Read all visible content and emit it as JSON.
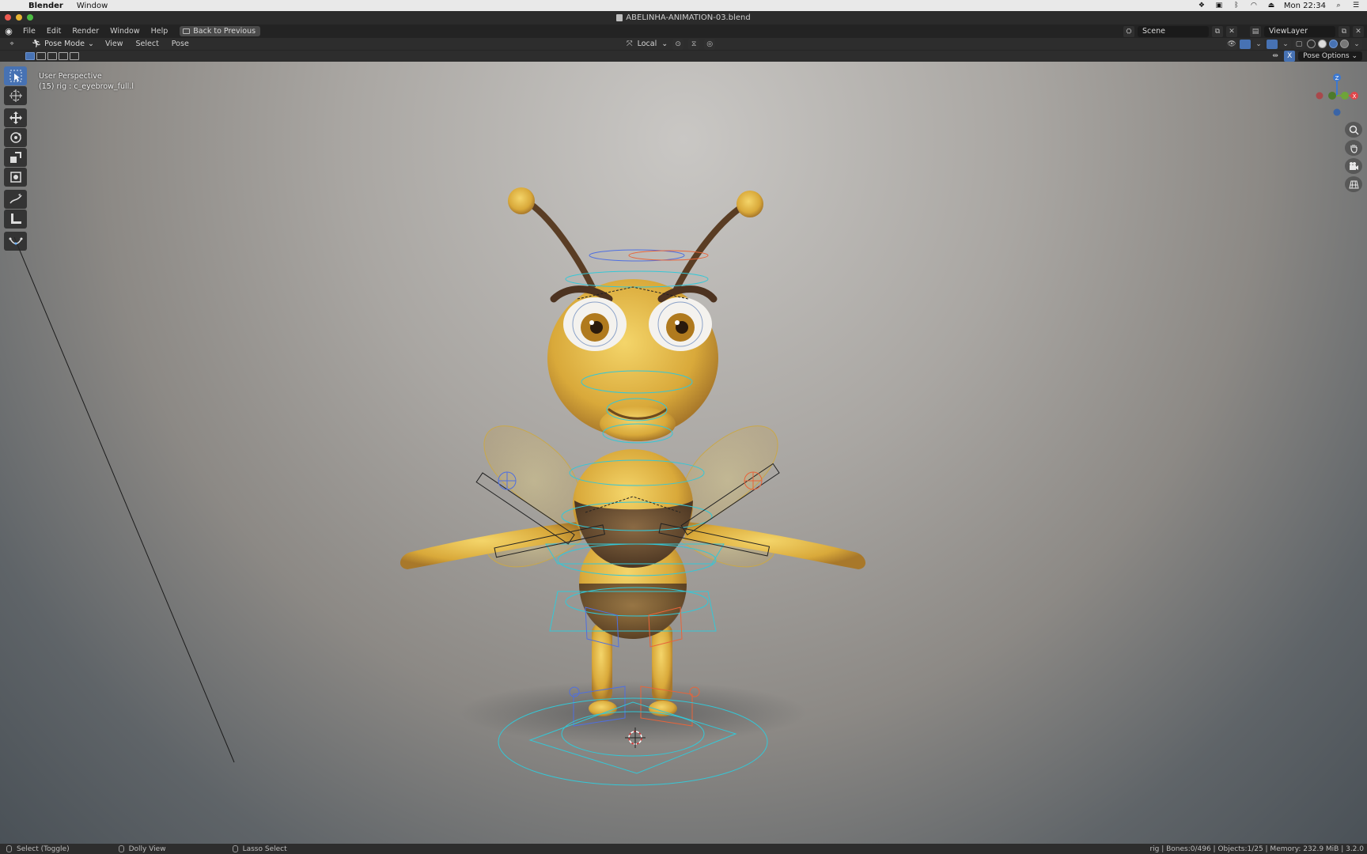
{
  "mac_menubar": {
    "app": "Blender",
    "items": [
      "Window"
    ],
    "clock": "Mon 22:34"
  },
  "window": {
    "title": "ABELINHA-ANIMATION-03.blend"
  },
  "topbar": {
    "menus": [
      "File",
      "Edit",
      "Render",
      "Window",
      "Help"
    ],
    "back_button": "Back to Previous",
    "scene": "Scene",
    "view_layer": "ViewLayer"
  },
  "viewport_header": {
    "mode": "Pose Mode",
    "menus": [
      "View",
      "Select",
      "Pose"
    ],
    "orientation": "Local"
  },
  "tool_settings": {
    "x_toggle": "X",
    "pose_options": "Pose Options"
  },
  "viewport": {
    "view_name": "User Perspective",
    "active": "(15) rig : c_eyebrow_full.l",
    "gizmo_axes": {
      "z": "Z",
      "x": "X"
    }
  },
  "status_bar": {
    "hints": [
      "Select (Toggle)",
      "Dolly View",
      "Lasso Select"
    ],
    "stats": "rig | Bones:0/496 | Objects:1/25 | Memory: 232.9 MiB | 3.2.0"
  },
  "colors": {
    "accent": "#4772b3",
    "gizmo_x": "#e0464a",
    "gizmo_y": "#6ea43a",
    "gizmo_z": "#3c78d0",
    "rig_cyan": "#35c7d6",
    "rig_left": "#4f6fe0",
    "rig_right": "#e8643a"
  }
}
